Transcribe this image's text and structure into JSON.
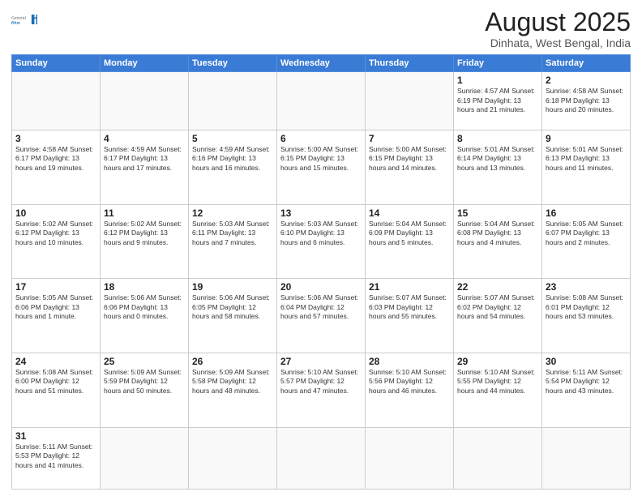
{
  "header": {
    "logo_general": "General",
    "logo_blue": "Blue",
    "title": "August 2025",
    "subtitle": "Dinhata, West Bengal, India"
  },
  "weekdays": [
    "Sunday",
    "Monday",
    "Tuesday",
    "Wednesday",
    "Thursday",
    "Friday",
    "Saturday"
  ],
  "weeks": [
    [
      {
        "day": "",
        "info": ""
      },
      {
        "day": "",
        "info": ""
      },
      {
        "day": "",
        "info": ""
      },
      {
        "day": "",
        "info": ""
      },
      {
        "day": "",
        "info": ""
      },
      {
        "day": "1",
        "info": "Sunrise: 4:57 AM\nSunset: 6:19 PM\nDaylight: 13 hours\nand 21 minutes."
      },
      {
        "day": "2",
        "info": "Sunrise: 4:58 AM\nSunset: 6:18 PM\nDaylight: 13 hours\nand 20 minutes."
      }
    ],
    [
      {
        "day": "3",
        "info": "Sunrise: 4:58 AM\nSunset: 6:17 PM\nDaylight: 13 hours\nand 19 minutes."
      },
      {
        "day": "4",
        "info": "Sunrise: 4:59 AM\nSunset: 6:17 PM\nDaylight: 13 hours\nand 17 minutes."
      },
      {
        "day": "5",
        "info": "Sunrise: 4:59 AM\nSunset: 6:16 PM\nDaylight: 13 hours\nand 16 minutes."
      },
      {
        "day": "6",
        "info": "Sunrise: 5:00 AM\nSunset: 6:15 PM\nDaylight: 13 hours\nand 15 minutes."
      },
      {
        "day": "7",
        "info": "Sunrise: 5:00 AM\nSunset: 6:15 PM\nDaylight: 13 hours\nand 14 minutes."
      },
      {
        "day": "8",
        "info": "Sunrise: 5:01 AM\nSunset: 6:14 PM\nDaylight: 13 hours\nand 13 minutes."
      },
      {
        "day": "9",
        "info": "Sunrise: 5:01 AM\nSunset: 6:13 PM\nDaylight: 13 hours\nand 11 minutes."
      }
    ],
    [
      {
        "day": "10",
        "info": "Sunrise: 5:02 AM\nSunset: 6:12 PM\nDaylight: 13 hours\nand 10 minutes."
      },
      {
        "day": "11",
        "info": "Sunrise: 5:02 AM\nSunset: 6:12 PM\nDaylight: 13 hours\nand 9 minutes."
      },
      {
        "day": "12",
        "info": "Sunrise: 5:03 AM\nSunset: 6:11 PM\nDaylight: 13 hours\nand 7 minutes."
      },
      {
        "day": "13",
        "info": "Sunrise: 5:03 AM\nSunset: 6:10 PM\nDaylight: 13 hours\nand 6 minutes."
      },
      {
        "day": "14",
        "info": "Sunrise: 5:04 AM\nSunset: 6:09 PM\nDaylight: 13 hours\nand 5 minutes."
      },
      {
        "day": "15",
        "info": "Sunrise: 5:04 AM\nSunset: 6:08 PM\nDaylight: 13 hours\nand 4 minutes."
      },
      {
        "day": "16",
        "info": "Sunrise: 5:05 AM\nSunset: 6:07 PM\nDaylight: 13 hours\nand 2 minutes."
      }
    ],
    [
      {
        "day": "17",
        "info": "Sunrise: 5:05 AM\nSunset: 6:06 PM\nDaylight: 13 hours\nand 1 minute."
      },
      {
        "day": "18",
        "info": "Sunrise: 5:06 AM\nSunset: 6:06 PM\nDaylight: 13 hours\nand 0 minutes."
      },
      {
        "day": "19",
        "info": "Sunrise: 5:06 AM\nSunset: 6:05 PM\nDaylight: 12 hours\nand 58 minutes."
      },
      {
        "day": "20",
        "info": "Sunrise: 5:06 AM\nSunset: 6:04 PM\nDaylight: 12 hours\nand 57 minutes."
      },
      {
        "day": "21",
        "info": "Sunrise: 5:07 AM\nSunset: 6:03 PM\nDaylight: 12 hours\nand 55 minutes."
      },
      {
        "day": "22",
        "info": "Sunrise: 5:07 AM\nSunset: 6:02 PM\nDaylight: 12 hours\nand 54 minutes."
      },
      {
        "day": "23",
        "info": "Sunrise: 5:08 AM\nSunset: 6:01 PM\nDaylight: 12 hours\nand 53 minutes."
      }
    ],
    [
      {
        "day": "24",
        "info": "Sunrise: 5:08 AM\nSunset: 6:00 PM\nDaylight: 12 hours\nand 51 minutes."
      },
      {
        "day": "25",
        "info": "Sunrise: 5:09 AM\nSunset: 5:59 PM\nDaylight: 12 hours\nand 50 minutes."
      },
      {
        "day": "26",
        "info": "Sunrise: 5:09 AM\nSunset: 5:58 PM\nDaylight: 12 hours\nand 48 minutes."
      },
      {
        "day": "27",
        "info": "Sunrise: 5:10 AM\nSunset: 5:57 PM\nDaylight: 12 hours\nand 47 minutes."
      },
      {
        "day": "28",
        "info": "Sunrise: 5:10 AM\nSunset: 5:56 PM\nDaylight: 12 hours\nand 46 minutes."
      },
      {
        "day": "29",
        "info": "Sunrise: 5:10 AM\nSunset: 5:55 PM\nDaylight: 12 hours\nand 44 minutes."
      },
      {
        "day": "30",
        "info": "Sunrise: 5:11 AM\nSunset: 5:54 PM\nDaylight: 12 hours\nand 43 minutes."
      }
    ],
    [
      {
        "day": "31",
        "info": "Sunrise: 5:11 AM\nSunset: 5:53 PM\nDaylight: 12 hours\nand 41 minutes."
      },
      {
        "day": "",
        "info": ""
      },
      {
        "day": "",
        "info": ""
      },
      {
        "day": "",
        "info": ""
      },
      {
        "day": "",
        "info": ""
      },
      {
        "day": "",
        "info": ""
      },
      {
        "day": "",
        "info": ""
      }
    ]
  ]
}
